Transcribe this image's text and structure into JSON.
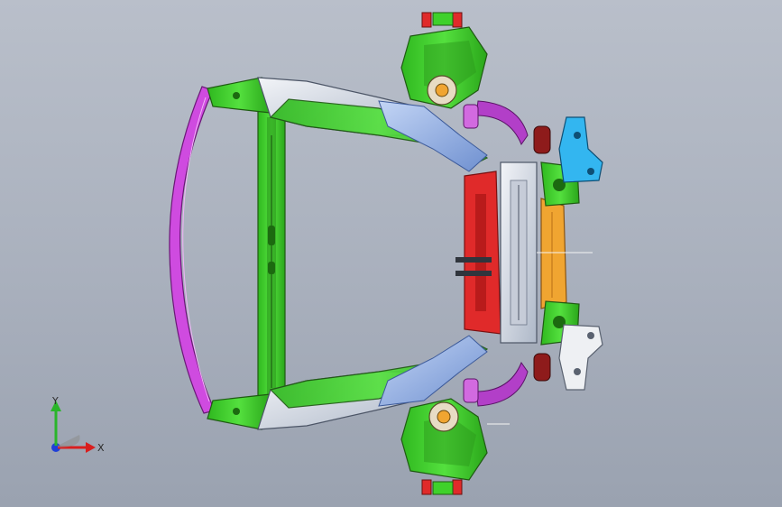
{
  "viewport": {
    "background_top": "#b9bfca",
    "background_bottom": "#9aa2b0"
  },
  "model": {
    "colors": {
      "frame_green": "#3fd12b",
      "frame_dark": "#1f5a12",
      "magenta": "#cf4be0",
      "steel": "#d8dde6",
      "blue_steel": "#8fb0e6",
      "red": "#e02a2a",
      "orange": "#f0a531",
      "cyan": "#33b6f0",
      "white_part": "#eef0f3",
      "purple": "#b23fc8",
      "brown_red": "#8e1b1b"
    }
  },
  "triad": {
    "x_label": "X",
    "y_label": "Y",
    "x_color": "#d91e1e",
    "y_color": "#2ab52a",
    "z_color": "#1f3fd8",
    "x_icon": "x-axis-arrow-icon",
    "y_icon": "y-axis-arrow-icon",
    "z_icon": "z-axis-dot-icon"
  }
}
